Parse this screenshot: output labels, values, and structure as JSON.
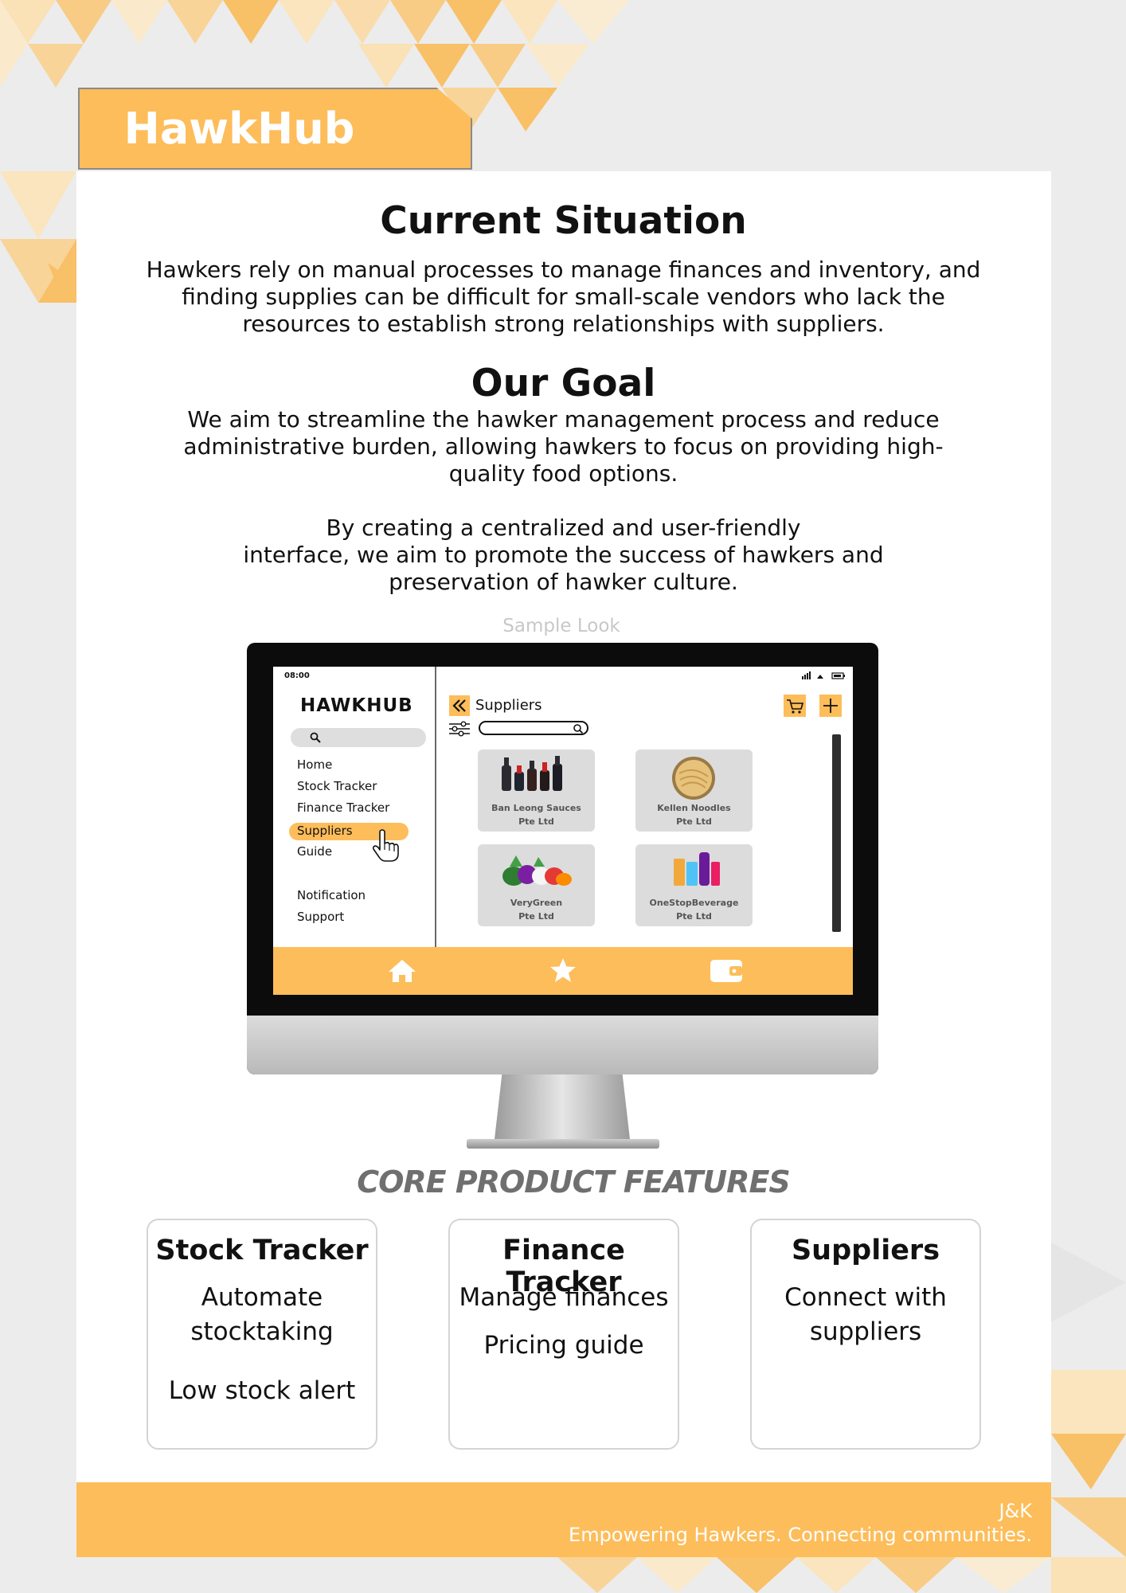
{
  "brand": {
    "name": "HawkHub"
  },
  "situation": {
    "heading": "Current Situation",
    "lines": [
      "Hawkers rely on manual processes to manage finances and inventory, and",
      "finding supplies can be difficult for small-scale vendors who lack the",
      "resources to establish strong relationships with suppliers."
    ]
  },
  "goal": {
    "heading": "Our Goal",
    "lines": [
      "We aim to streamline the hawker management process and reduce",
      "administrative burden, allowing hawkers to focus on providing high-",
      "quality food options."
    ],
    "lines2": [
      "By creating a centralized and user-friendly",
      "interface, we aim to promote the success of hawkers and",
      "preservation of hawker culture."
    ]
  },
  "sample_label": "Sample Look",
  "app": {
    "time": "08:00",
    "logo": "HAWKHUB",
    "nav": [
      "Home",
      "Stock Tracker",
      "Finance Tracker",
      "Suppliers",
      "Guide"
    ],
    "nav2": [
      "Notification",
      "Support"
    ],
    "active_nav": "Suppliers",
    "page_title": "Suppliers",
    "suppliers": [
      {
        "line1": "Ban Leong Sauces",
        "line2": "Pte Ltd",
        "icon": "sauce-bottles"
      },
      {
        "line1": "Kellen Noodles",
        "line2": "Pte Ltd",
        "icon": "noodle-bowl"
      },
      {
        "line1": "VeryGreen",
        "line2": "Pte Ltd",
        "icon": "vegetables"
      },
      {
        "line1": "OneStopBeverage",
        "line2": "Pte Ltd",
        "icon": "drinks"
      }
    ],
    "bottom_icons": [
      "home-icon",
      "star-icon",
      "wallet-icon"
    ]
  },
  "features": {
    "heading": "CORE PRODUCT FEATURES",
    "cards": [
      {
        "title": "Stock Tracker",
        "lines": [
          "Automate",
          "stocktaking",
          "",
          "Low stock alert"
        ]
      },
      {
        "title": "Finance Tracker",
        "lines": [
          "Manage finances",
          "Pricing guide"
        ]
      },
      {
        "title": "Suppliers",
        "lines": [
          "Connect with",
          "suppliers"
        ]
      }
    ]
  },
  "footer": {
    "author": "J&K",
    "tagline": "Empowering Hawkers. Connecting communities."
  },
  "colors": {
    "accent": "#fdbd5a",
    "background": "#ececec",
    "card": "#ffffff"
  }
}
